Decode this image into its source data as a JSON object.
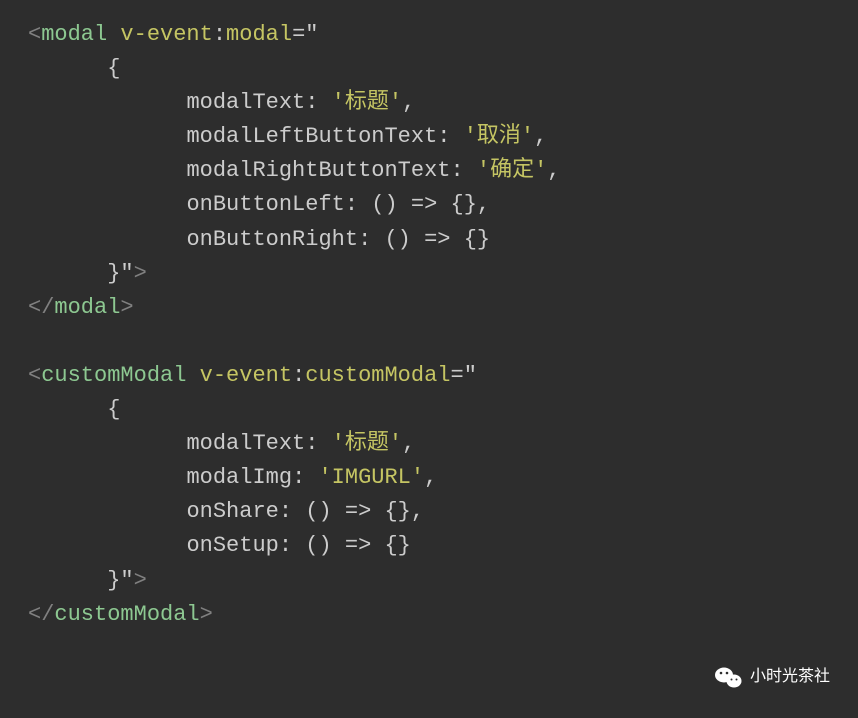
{
  "code": {
    "block1": {
      "openTag": "modal",
      "directive": "v-event",
      "directiveArg": "modal",
      "props": {
        "modalText": "'标题'",
        "modalLeftButtonText": "'取消'",
        "modalRightButtonText": "'确定'",
        "onButtonLeft": "() => {}",
        "onButtonRight": "() => {}"
      },
      "closeTag": "modal"
    },
    "block2": {
      "openTag": "customModal",
      "directive": "v-event",
      "directiveArg": "customModal",
      "props": {
        "modalText": "'标题'",
        "modalImg": "'IMGURL'",
        "onShare": "() => {}",
        "onSetup": "() => {}"
      },
      "closeTag": "customModal"
    }
  },
  "watermark": {
    "text": "小时光茶社"
  }
}
